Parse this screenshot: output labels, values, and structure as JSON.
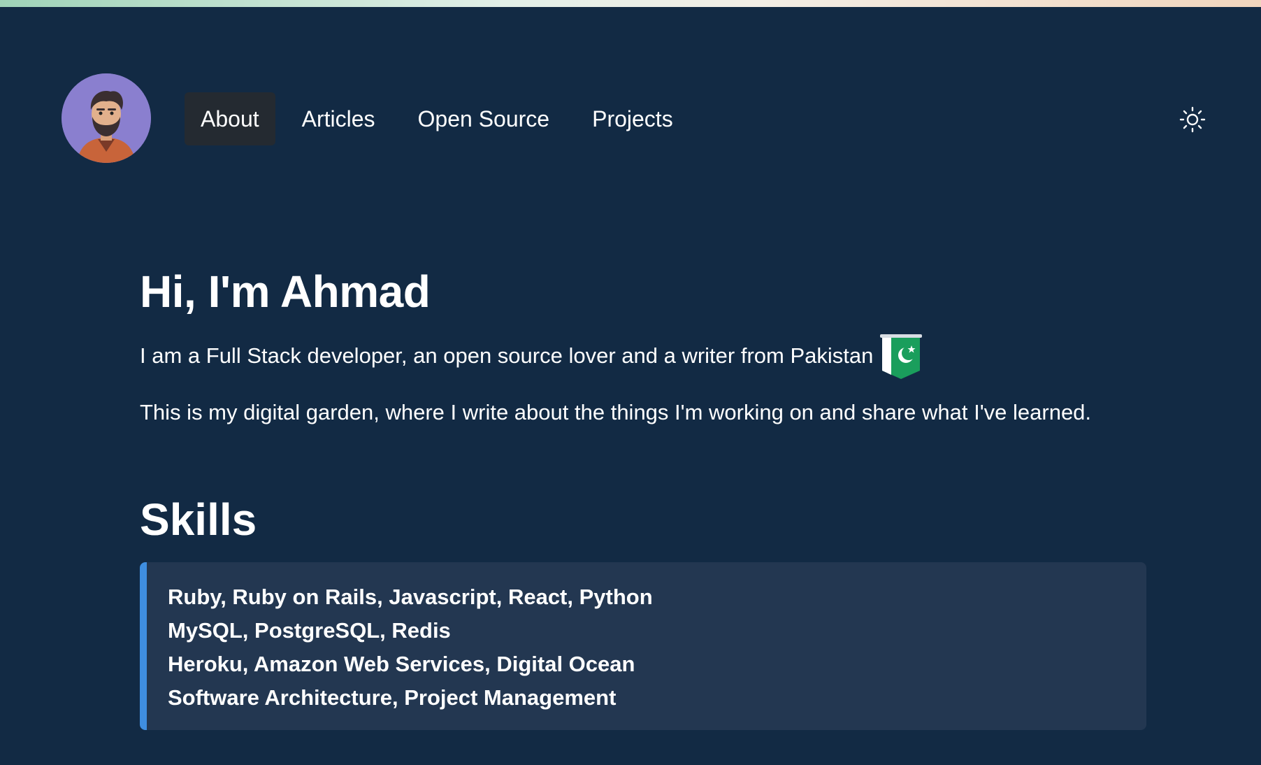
{
  "nav": {
    "items": [
      {
        "label": "About",
        "active": true
      },
      {
        "label": "Articles",
        "active": false
      },
      {
        "label": "Open Source",
        "active": false
      },
      {
        "label": "Projects",
        "active": false
      }
    ]
  },
  "header": {
    "avatar_icon": "avatar-icon",
    "theme_toggle_icon": "sun-icon"
  },
  "hero": {
    "title": "Hi, I'm Ahmad",
    "intro": "I am a Full Stack developer, an open source lover and a writer from Pakistan",
    "flag_icon": "pakistan-flag-icon",
    "garden": "This is my digital garden, where I write about the things I'm working on and share what I've learned."
  },
  "skills": {
    "title": "Skills",
    "lines": [
      "Ruby, Ruby on Rails, Javascript, React, Python",
      "MySQL, PostgreSQL, Redis",
      "Heroku, Amazon Web Services, Digital Ocean",
      "Software Architecture, Project Management"
    ]
  },
  "colors": {
    "background": "#122a44",
    "nav_active": "#242a31",
    "skills_box": "#233751",
    "skills_accent": "#3f8ee0",
    "flag_green": "#1a9e5c"
  }
}
